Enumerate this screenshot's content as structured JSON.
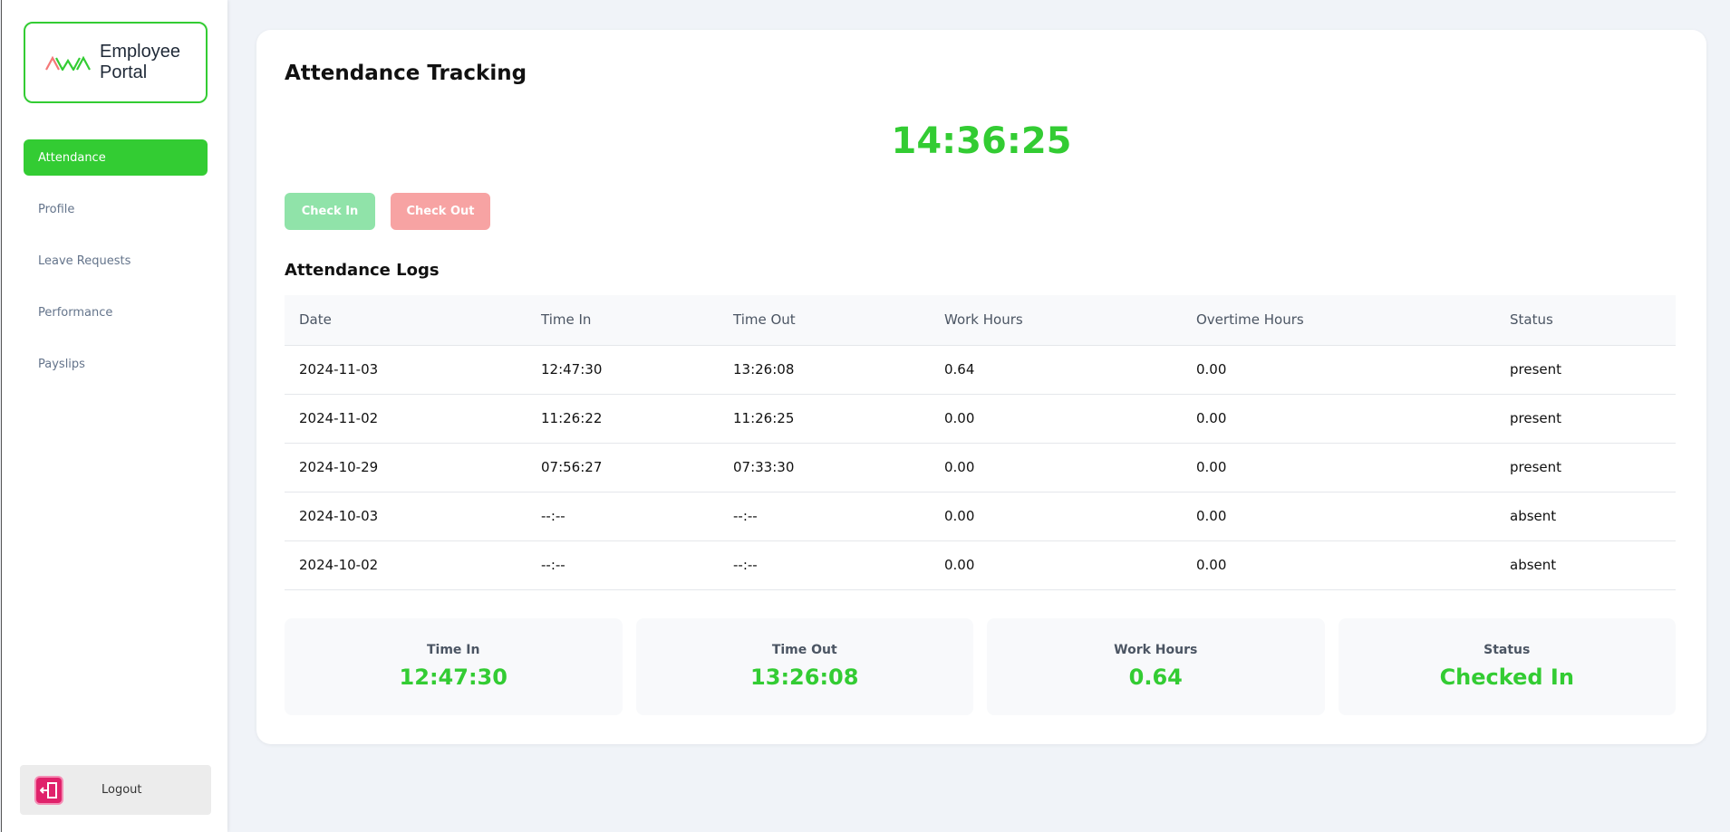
{
  "brand": {
    "line1": "Employee",
    "line2": "Portal",
    "logo_icon": "awa-logo-icon"
  },
  "sidebar": {
    "items": [
      {
        "label": "Attendance",
        "active": true
      },
      {
        "label": "Profile",
        "active": false
      },
      {
        "label": "Leave Requests",
        "active": false
      },
      {
        "label": "Performance",
        "active": false
      },
      {
        "label": "Payslips",
        "active": false
      }
    ],
    "logout_label": "Logout",
    "logout_icon": "logout-icon"
  },
  "main": {
    "title": "Attendance Tracking",
    "clock": "14:36:25",
    "check_in_label": "Check In",
    "check_out_label": "Check Out",
    "logs_title": "Attendance Logs",
    "table": {
      "headers": [
        "Date",
        "Time In",
        "Time Out",
        "Work Hours",
        "Overtime Hours",
        "Status"
      ],
      "rows": [
        [
          "2024-11-03",
          "12:47:30",
          "13:26:08",
          "0.64",
          "0.00",
          "present"
        ],
        [
          "2024-11-02",
          "11:26:22",
          "11:26:25",
          "0.00",
          "0.00",
          "present"
        ],
        [
          "2024-10-29",
          "07:56:27",
          "07:33:30",
          "0.00",
          "0.00",
          "present"
        ],
        [
          "2024-10-03",
          "--:--",
          "--:--",
          "0.00",
          "0.00",
          "absent"
        ],
        [
          "2024-10-02",
          "--:--",
          "--:--",
          "0.00",
          "0.00",
          "absent"
        ]
      ]
    },
    "summary": [
      {
        "label": "Time In",
        "value": "12:47:30"
      },
      {
        "label": "Time Out",
        "value": "13:26:08"
      },
      {
        "label": "Work Hours",
        "value": "0.64"
      },
      {
        "label": "Status",
        "value": "Checked In"
      }
    ]
  },
  "colors": {
    "accent": "#33cc33",
    "check_in": "#90e3a9",
    "check_out": "#f7a3a3",
    "logout": "#e0226b"
  }
}
